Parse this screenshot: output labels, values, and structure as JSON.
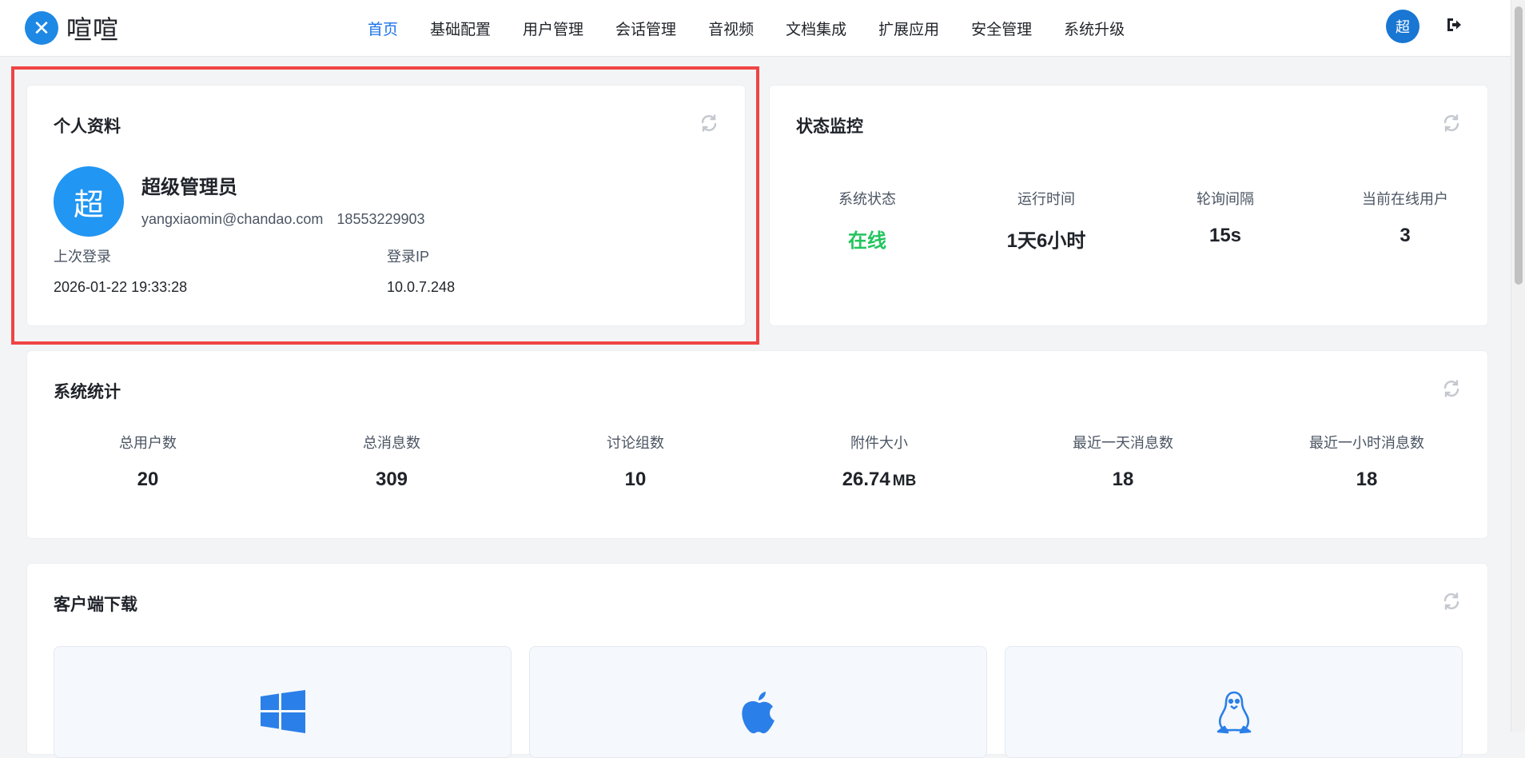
{
  "brand": {
    "name": "喧喧",
    "logo_glyph": "✕"
  },
  "nav": {
    "items": [
      {
        "label": "首页",
        "active": true
      },
      {
        "label": "基础配置",
        "active": false
      },
      {
        "label": "用户管理",
        "active": false
      },
      {
        "label": "会话管理",
        "active": false
      },
      {
        "label": "音视频",
        "active": false
      },
      {
        "label": "文档集成",
        "active": false
      },
      {
        "label": "扩展应用",
        "active": false
      },
      {
        "label": "安全管理",
        "active": false
      },
      {
        "label": "系统升级",
        "active": false
      }
    ],
    "avatar_text": "超",
    "logout_icon": "logout-icon"
  },
  "profile": {
    "title": "个人资料",
    "avatar_text": "超",
    "name": "超级管理员",
    "email": "yangxiaomin@chandao.com",
    "phone": "18553229903",
    "last_login_label": "上次登录",
    "last_login_value": "2026-01-22 19:33:28",
    "ip_label": "登录IP",
    "ip_value": "10.0.7.248"
  },
  "status": {
    "title": "状态监控",
    "items": [
      {
        "label": "系统状态",
        "value": "在线"
      },
      {
        "label": "运行时间",
        "value": "1天6小时"
      },
      {
        "label": "轮询间隔",
        "value": "15s"
      },
      {
        "label": "当前在线用户",
        "value": "3"
      }
    ]
  },
  "stats": {
    "title": "系统统计",
    "items": [
      {
        "label": "总用户数",
        "value": "20"
      },
      {
        "label": "总消息数",
        "value": "309"
      },
      {
        "label": "讨论组数",
        "value": "10"
      },
      {
        "label": "附件大小",
        "value": "26.74",
        "unit": "MB"
      },
      {
        "label": "最近一天消息数",
        "value": "18"
      },
      {
        "label": "最近一小时消息数",
        "value": "18"
      }
    ]
  },
  "downloads": {
    "title": "客户端下载",
    "items": [
      {
        "icon": "windows-icon"
      },
      {
        "icon": "apple-icon"
      },
      {
        "icon": "linux-icon"
      }
    ]
  },
  "colors": {
    "accent": "#1a73e8",
    "online": "#22c55e",
    "highlight": "#ef4444"
  }
}
